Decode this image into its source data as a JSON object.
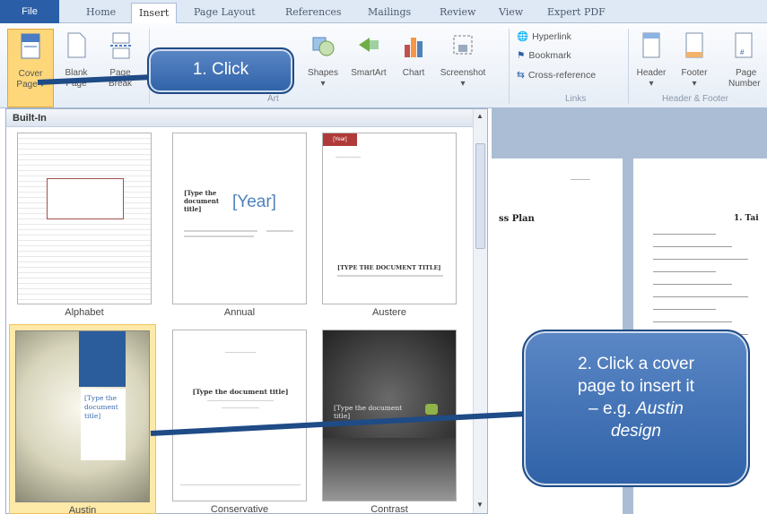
{
  "tabs": [
    "File",
    "Home",
    "Insert",
    "Page Layout",
    "References",
    "Mailings",
    "Review",
    "View",
    "Expert PDF"
  ],
  "ribbon": {
    "cover_page": [
      "Cover",
      "Page ▾"
    ],
    "blank_page": [
      "Blank",
      "Page"
    ],
    "page_break": [
      "Page",
      "Break"
    ],
    "shapes": "Shapes",
    "smartart": "SmartArt",
    "chart": "Chart",
    "screenshot": "Screenshot",
    "art_group": "Art",
    "hyperlink": "Hyperlink",
    "bookmark": "Bookmark",
    "cross_reference": "Cross-reference",
    "links_group": "Links",
    "header": "Header",
    "footer": "Footer",
    "page_number": [
      "Page",
      "Number"
    ],
    "header_footer_group": "Header & Footer"
  },
  "gallery": {
    "heading": "Built-In",
    "items": [
      "Alphabet",
      "Annual",
      "Austere",
      "Austin",
      "Conservative",
      "Contrast"
    ],
    "annual_title": "[Type the document title]",
    "annual_year": "[Year]",
    "austere_year": "[Year]",
    "austere_title": "[TYPE THE DOCUMENT TITLE]",
    "austin_title": "[Type the document title]",
    "conservative_title": "[Type the document title]",
    "contrast_title": "[Type the document title]"
  },
  "callouts": {
    "one": "1. Click",
    "two_line1": "2. Click a cover",
    "two_line2": "page to insert it",
    "two_line3": "– e.g. ",
    "two_em1": "Austin",
    "two_em2": "design"
  },
  "document": {
    "left_heading": "ss Plan",
    "right_heading": "1.   Tai"
  },
  "colors": {
    "callout": "#3a6db5",
    "selection": "#fde9a8",
    "ribbon_accent": "#2a5fa8"
  }
}
